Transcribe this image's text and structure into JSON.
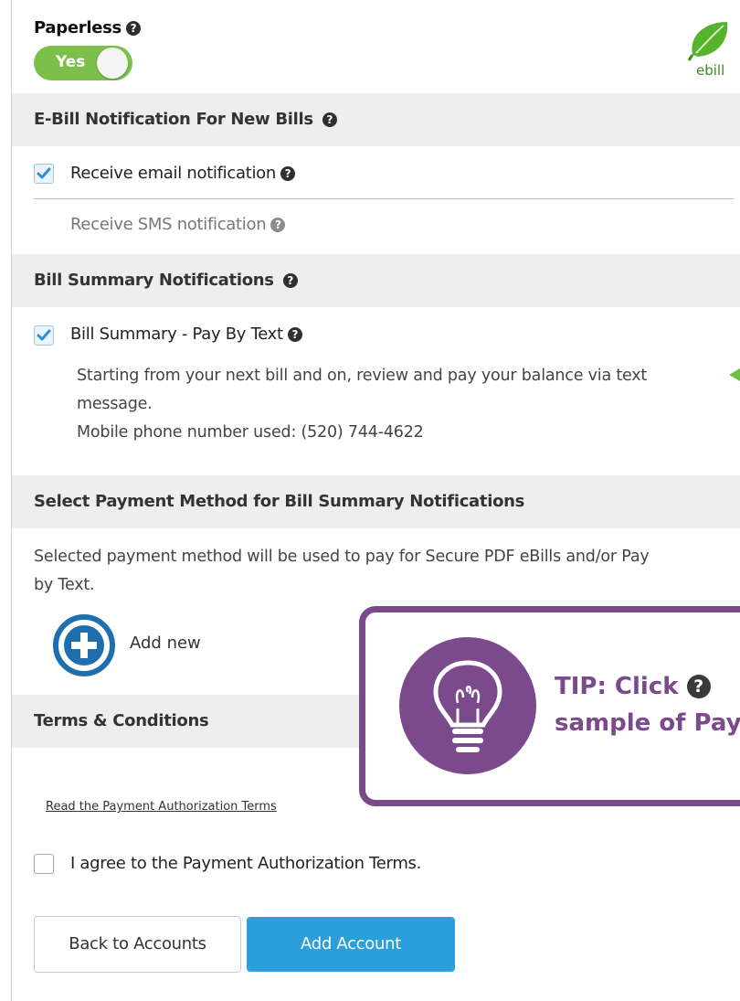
{
  "paperless": {
    "title": "Paperless",
    "toggle_label": "Yes",
    "toggle_on": true,
    "ebill_label": "ebill"
  },
  "ebill_notifications": {
    "header": "E-Bill Notification For New Bills",
    "email_label": "Receive email notification",
    "email_checked": true,
    "sms_label": "Receive SMS notification",
    "sms_checked": false
  },
  "bill_summary": {
    "header": "Bill Summary Notifications",
    "pay_by_text_label": "Bill Summary - Pay By Text",
    "pay_by_text_checked": true,
    "description_line1": "Starting from your next bill and on, review and pay your balance via text",
    "description_line2": "message.",
    "phone_line": "Mobile phone number used: (520) 744-4622"
  },
  "payment_method": {
    "header": "Select Payment Method for Bill Summary Notifications",
    "description_line1": "Selected payment method will be used to pay for Secure PDF eBills and/or Pay",
    "description_line2": "by Text.",
    "add_new_label": "Add new"
  },
  "terms": {
    "header": "Terms & Conditions",
    "link_text": "Read the Payment Authorization Terms",
    "agree_label": "I agree to the Payment Authorization Terms.",
    "agree_checked": false
  },
  "buttons": {
    "back_label": "Back to Accounts",
    "add_account_label": "Add Account"
  },
  "tip": {
    "prefix": "TIP",
    "line1_rest": ": Click",
    "line2": "sample of Pay"
  },
  "colors": {
    "toggle_green": "#7cc04b",
    "accent_blue": "#2b9fdc",
    "check_blue": "#2d8fd5",
    "tip_purple": "#7a4a8c",
    "plus_blue": "#1f6fae"
  }
}
